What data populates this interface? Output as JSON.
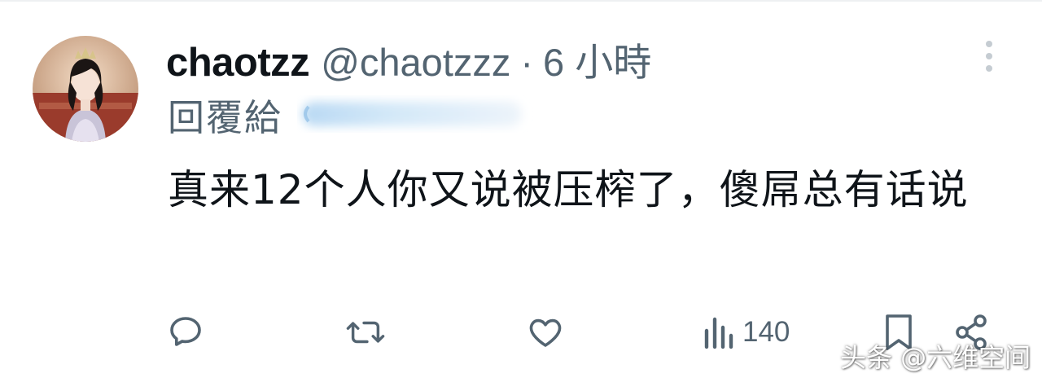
{
  "tweet": {
    "display_name": "chaotzz",
    "handle": "@chaotzzz",
    "separator": "·",
    "time": "6 小時",
    "reply_label": "回覆給",
    "body": "真来12个人你又说被压榨了，傻屌总有话说"
  },
  "actions": {
    "reply_icon": "speech-bubble-icon",
    "retweet_icon": "retweet-icon",
    "like_icon": "heart-icon",
    "views_icon": "bar-chart-icon",
    "views_count": "140",
    "bookmark_icon": "bookmark-icon",
    "share_icon": "share-icon"
  },
  "watermark": "头条 @六维空间",
  "colors": {
    "text_primary": "#0f1419",
    "text_secondary": "#536471",
    "icon": "#536471",
    "background": "#ffffff"
  }
}
